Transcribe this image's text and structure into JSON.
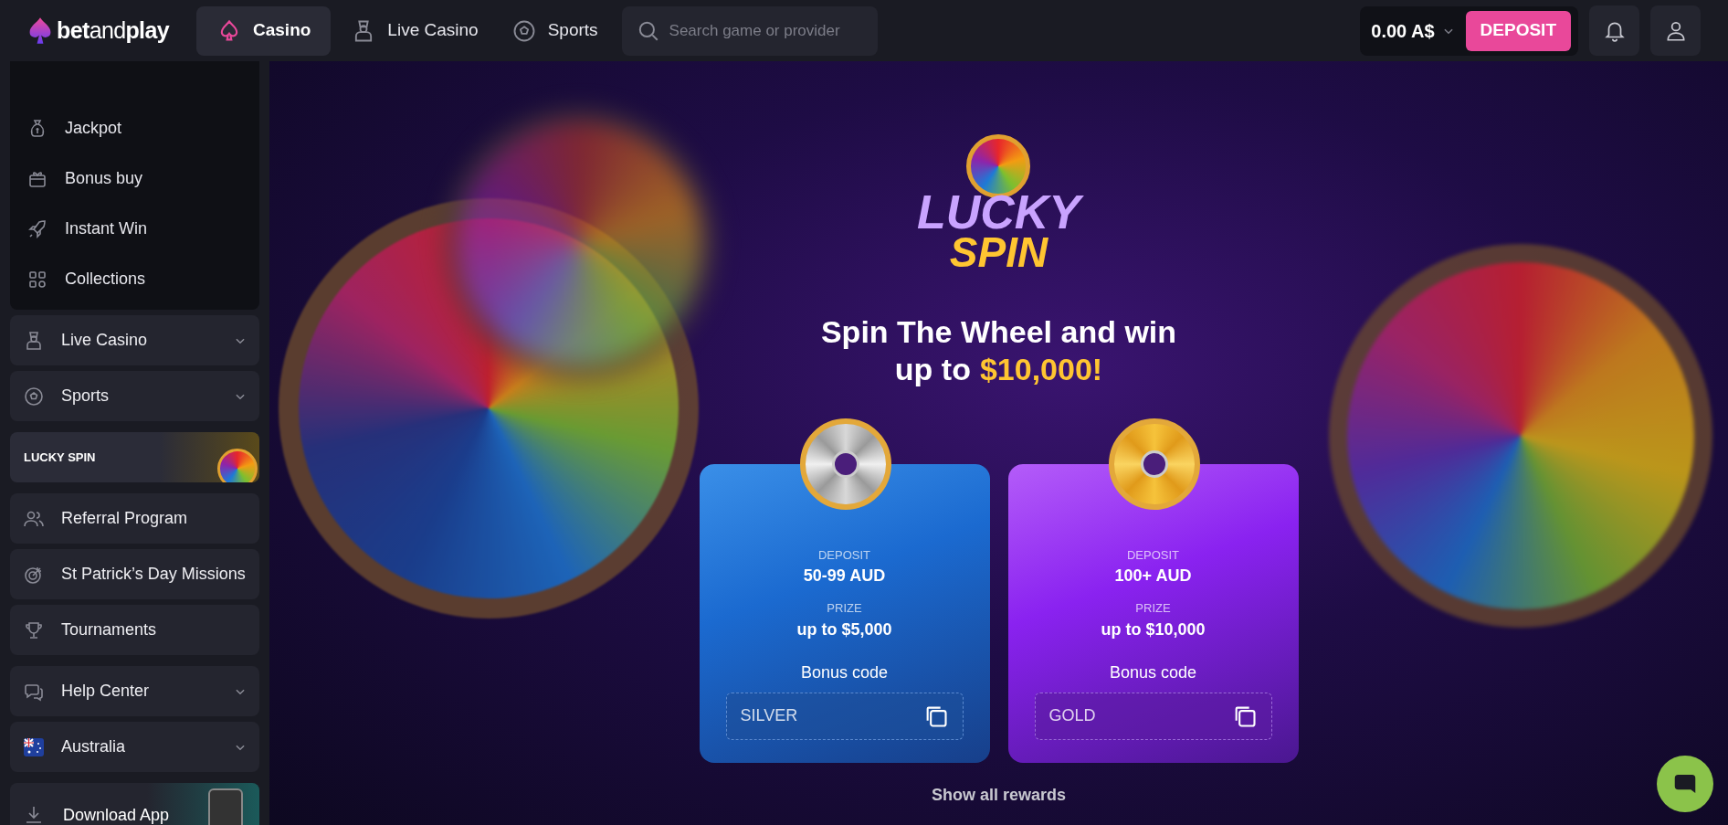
{
  "header": {
    "logo": "**bet**and**play**",
    "nav_tabs": [
      {
        "label": "Casino",
        "selected": true
      },
      {
        "label": "Live Casino",
        "selected": false
      },
      {
        "label": "Sports",
        "selected": false
      }
    ],
    "search": {
      "placeholder": "Search game or provider"
    },
    "balance": "0.00 A$",
    "deposit_button": "DEPOSIT"
  },
  "sidebar": {
    "submenu": [
      {
        "label": "Jackpot"
      },
      {
        "label": "Bonus buy"
      },
      {
        "label": "Instant Win"
      },
      {
        "label": "Collections"
      }
    ],
    "groups": [
      [
        {
          "kind": "dropdown",
          "label": "Live Casino"
        },
        {
          "kind": "dropdown",
          "label": "Sports"
        }
      ],
      [
        {
          "kind": "banner",
          "label": "LUCKY SPIN"
        }
      ],
      [
        {
          "kind": "link",
          "label": "Referral Program"
        },
        {
          "kind": "link",
          "label": "St Patrick’s Day Missions"
        },
        {
          "kind": "link",
          "label": "Tournaments"
        }
      ],
      [
        {
          "kind": "dropdown",
          "label": "Help Center"
        },
        {
          "kind": "dropdown",
          "label": "Australia"
        }
      ],
      [
        {
          "kind": "app",
          "label": "Download App"
        }
      ]
    ]
  },
  "hero": {
    "logo": {
      "line_1": "LUCKY",
      "line_2": "SPIN"
    },
    "heading": {
      "line_1": "Spin The Wheel and win",
      "line_2": "up to",
      "amount": "$10,000!"
    },
    "cards": [
      {
        "kind": "silver",
        "deposit_label": "DEPOSIT",
        "deposit": "50-99 AUD",
        "prize_label": "PRIZE",
        "prize": "up to $5,000",
        "code_label": "Bonus code",
        "code": "SILVER"
      },
      {
        "kind": "gold",
        "deposit_label": "DEPOSIT",
        "deposit": "100+ AUD",
        "prize_label": "PRIZE",
        "prize": "up to $10,000",
        "code_label": "Bonus code",
        "code": "GOLD"
      }
    ],
    "show_all": "Show all rewards"
  }
}
